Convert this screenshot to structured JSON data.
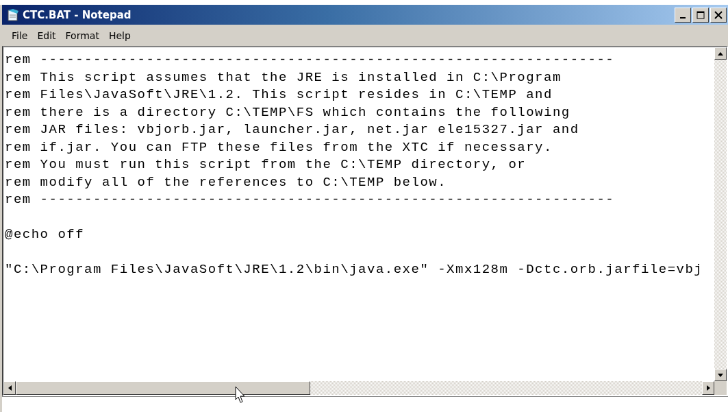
{
  "window": {
    "title": "CTC.BAT - Notepad"
  },
  "menu": [
    "File",
    "Edit",
    "Format",
    "Help"
  ],
  "editor": {
    "blocks": [
      {
        "lines": [
          "rem -----------------------------------------------------------------",
          "rem This script assumes that the JRE is installed in C:\\Program",
          "rem Files\\JavaSoft\\JRE\\1.2. This script resides in C:\\TEMP and",
          "rem there is a directory C:\\TEMP\\FS which contains the following",
          "rem JAR files: vbjorb.jar, launcher.jar, net.jar ele15327.jar and",
          "rem if.jar. You can FTP these files from the XTC if necessary.",
          "rem You must run this script from the C:\\TEMP directory, or",
          "rem modify all of the references to C:\\TEMP below.",
          "rem -----------------------------------------------------------------"
        ]
      },
      {
        "lines": [
          "@echo off"
        ]
      },
      {
        "lines": [
          "\"C:\\Program Files\\JavaSoft\\JRE\\1.2\\bin\\java.exe\" -Xmx128m -Dctc.orb.jarfile=vbj"
        ]
      }
    ]
  }
}
